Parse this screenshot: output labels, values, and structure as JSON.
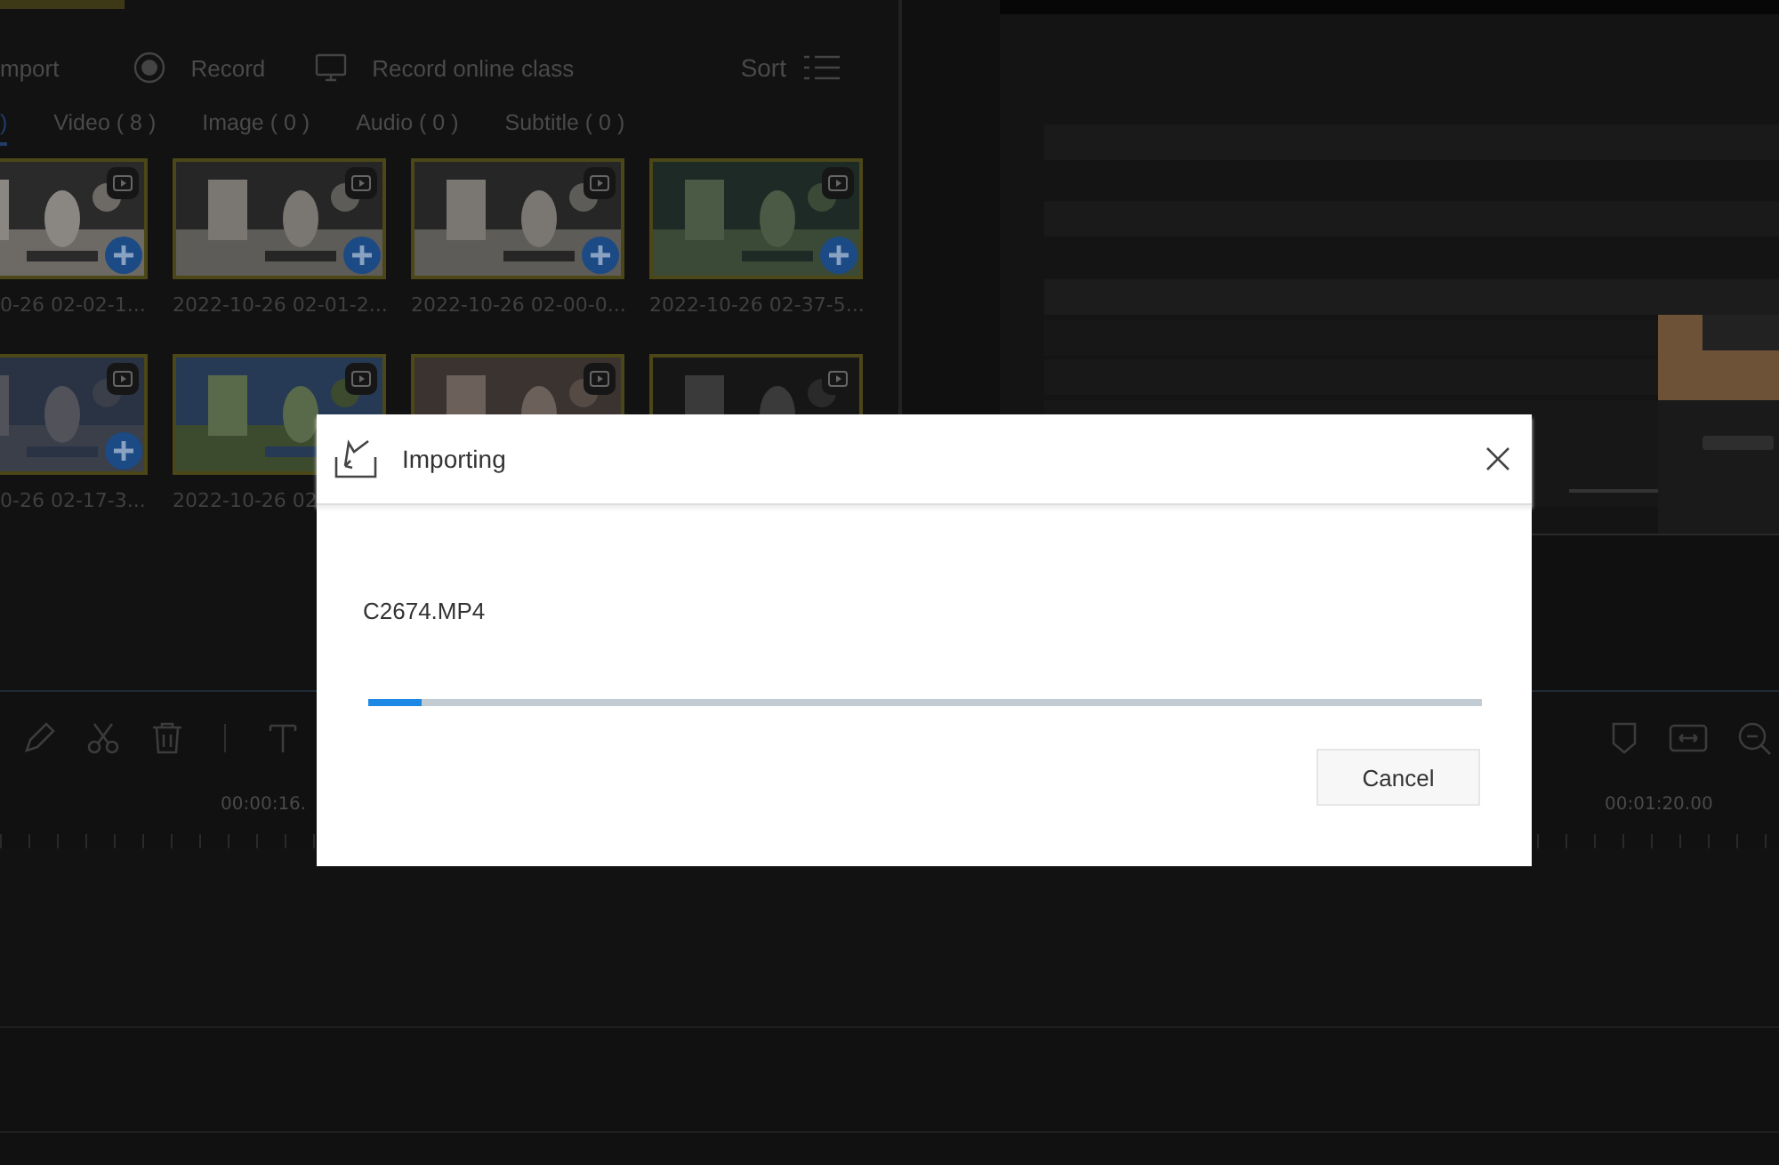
{
  "media_toolbar": {
    "items": [
      {
        "kind": "import",
        "label": "mport"
      },
      {
        "kind": "record",
        "label": "Record"
      },
      {
        "kind": "online",
        "label": "Record online class"
      }
    ],
    "sort": "Sort"
  },
  "media_tabs": [
    {
      "label": ")",
      "selected": true
    },
    {
      "label": "Video ( 8 )",
      "selected": false
    },
    {
      "label": "Image ( 0 )",
      "selected": false
    },
    {
      "label": "Audio ( 0 )",
      "selected": false
    },
    {
      "label": "Subtitle ( 0 )",
      "selected": false
    }
  ],
  "thumbnails": [
    {
      "kind": "picture",
      "caption": "0-26 02-02-1...",
      "add_icon": true
    },
    {
      "kind": "picture",
      "caption": "2022-10-26 02-01-2...",
      "add_icon": true
    },
    {
      "kind": "picture",
      "caption": "2022-10-26 02-00-0...",
      "add_icon": true
    },
    {
      "kind": "picture",
      "caption": "2022-10-26 02-37-5...",
      "add_icon": true
    },
    {
      "kind": "picture",
      "caption": "0-26 02-17-3...",
      "add_icon": true
    },
    {
      "kind": "picture",
      "caption": "2022-10-26 02"
    },
    {
      "kind": "picture"
    },
    {
      "kind": "picture"
    }
  ],
  "preview": {
    "kind": "picture"
  },
  "timeline": {
    "ruler_labels": [
      "00:00:16.",
      "00:01:20.00"
    ]
  },
  "dialog": {
    "title": "Importing",
    "file_name": "C2674.MP4",
    "level": 0.048,
    "buttons": [
      "Cancel"
    ]
  }
}
